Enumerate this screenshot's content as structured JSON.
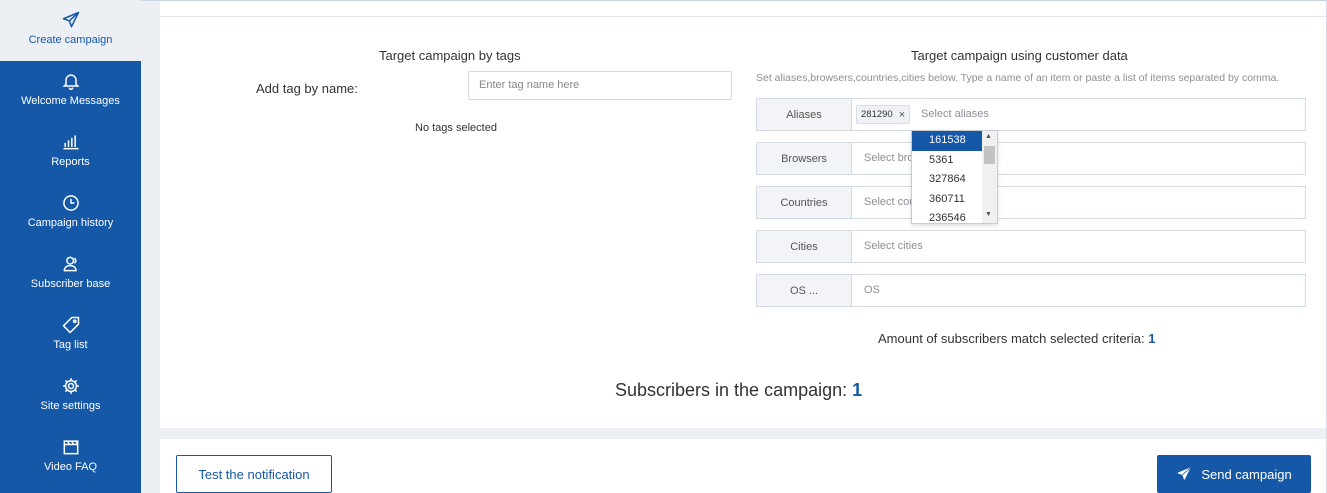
{
  "sidebar": {
    "items": [
      {
        "label": "Create campaign",
        "icon": "paper-plane-icon"
      },
      {
        "label": "Welcome Messages",
        "icon": "bell-icon"
      },
      {
        "label": "Reports",
        "icon": "bar-chart-icon"
      },
      {
        "label": "Campaign history",
        "icon": "clock-icon"
      },
      {
        "label": "Subscriber base",
        "icon": "users-icon"
      },
      {
        "label": "Tag list",
        "icon": "tag-icon"
      },
      {
        "label": "Site settings",
        "icon": "gear-icon"
      },
      {
        "label": "Video FAQ",
        "icon": "clapperboard-icon"
      }
    ]
  },
  "tags_section": {
    "title": "Target campaign by tags",
    "add_label": "Add tag by name:",
    "input_placeholder": "Enter tag name here",
    "empty_text": "No tags selected"
  },
  "customer_section": {
    "title": "Target campaign using customer data",
    "hint": "Set aliases,browsers,countries,cities below. Type a name of an item or paste a list of items separated by comma.",
    "rows": [
      {
        "label": "Aliases",
        "placeholder": "Select aliases"
      },
      {
        "label": "Browsers",
        "placeholder": "Select bro"
      },
      {
        "label": "Countries",
        "placeholder": "Select cou"
      },
      {
        "label": "Cities",
        "placeholder": "Select cities"
      },
      {
        "label": "OS ...",
        "placeholder": "OS"
      }
    ],
    "selected_alias": "281290",
    "dropdown_options": [
      "161538",
      "5361",
      "327864",
      "360711",
      "236546"
    ],
    "amount_label": "Amount of subscribers match selected criteria:",
    "amount_value": "1"
  },
  "summary": {
    "label": "Subscribers in the campaign:",
    "value": "1"
  },
  "footer": {
    "test_button": "Test the notification",
    "send_button": "Send campaign"
  },
  "colors": {
    "brand": "#1558a8",
    "background": "#eceff3"
  }
}
